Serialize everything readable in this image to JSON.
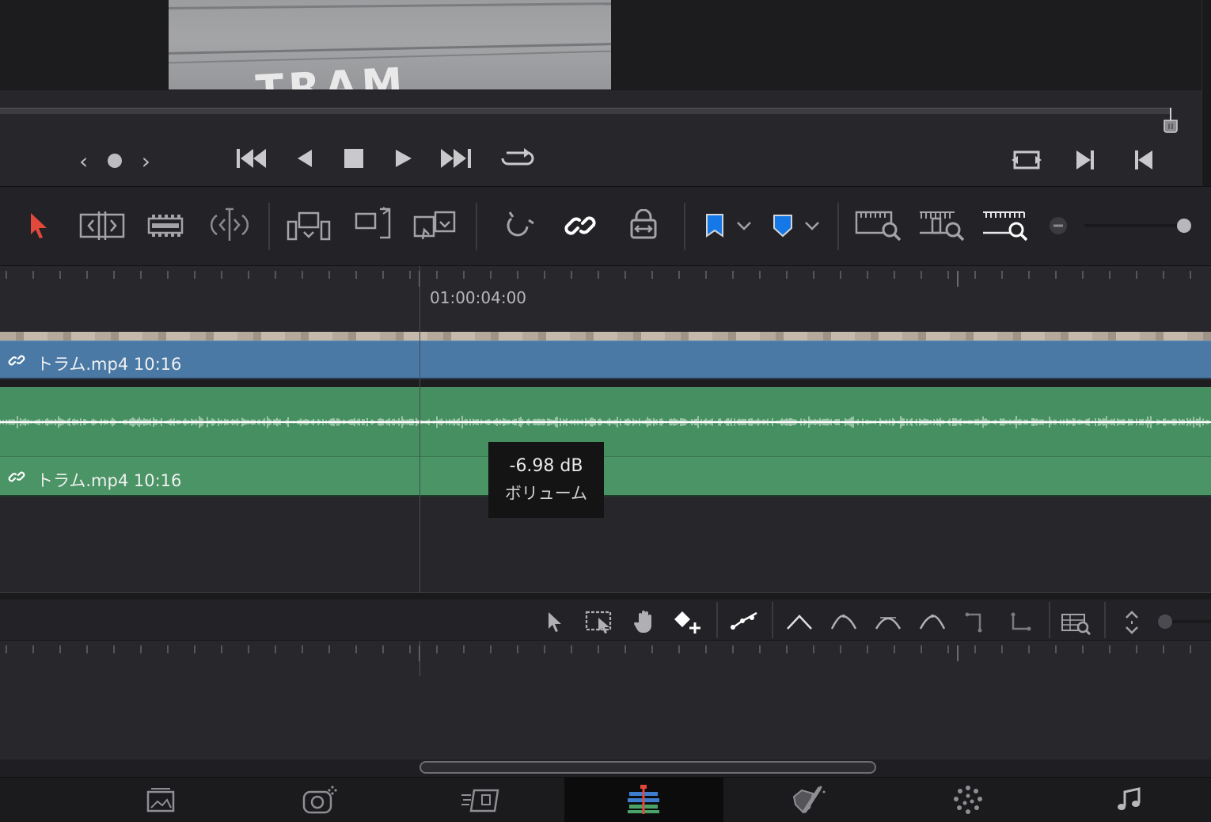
{
  "viewer": {
    "frame_text": "TRAM"
  },
  "timeline": {
    "ruler_timecode": "01:00:04:00",
    "video_clip": {
      "label": "トラム.mp4  10:16"
    },
    "audio_clip": {
      "label": "トラム.mp4  10:16"
    }
  },
  "tooltip": {
    "value": "-6.98 dB",
    "label": "ボリューム"
  },
  "colors": {
    "video_clip": "#4a79a6",
    "audio_clip": "#458f60",
    "select_tool": "#e2493b",
    "marker_flag": "#1478e6"
  }
}
